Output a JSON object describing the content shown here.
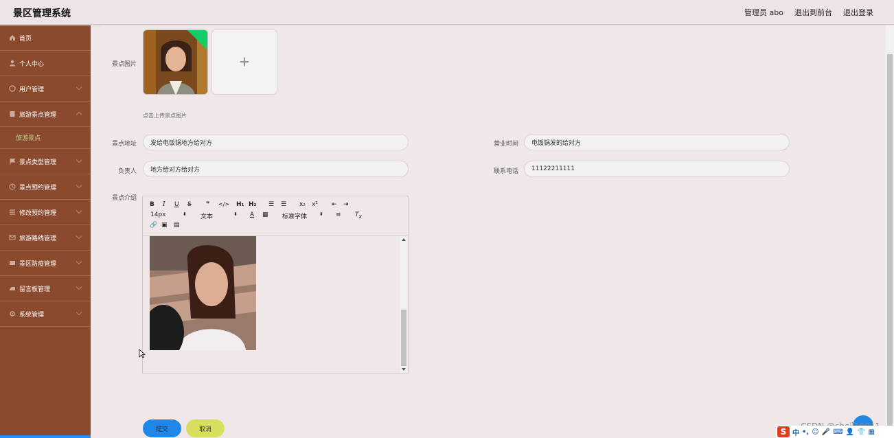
{
  "app": {
    "title": "景区管理系统"
  },
  "topnav": {
    "admin": "管理员 abo",
    "front": "退出到前台",
    "logout": "退出登录"
  },
  "sidebar": {
    "items": [
      {
        "label": "首页",
        "icon": "home-icon"
      },
      {
        "label": "个人中心",
        "icon": "user-icon"
      },
      {
        "label": "用户管理",
        "icon": "users-icon"
      },
      {
        "label": "旅游景点管理",
        "icon": "scenic-icon"
      },
      {
        "label": "景点类型管理",
        "icon": "flag-icon"
      },
      {
        "label": "景点预约管理",
        "icon": "clock-icon"
      },
      {
        "label": "修改预约管理",
        "icon": "list-icon"
      },
      {
        "label": "旅游路线管理",
        "icon": "mail-icon"
      },
      {
        "label": "景区防疫管理",
        "icon": "shield-icon"
      },
      {
        "label": "留言板管理",
        "icon": "message-icon"
      },
      {
        "label": "系统管理",
        "icon": "gear-icon"
      }
    ],
    "subitem": "旅游景点"
  },
  "form": {
    "image_label": "景点图片",
    "upload_hint": "点击上传景点图片",
    "address_label": "景点地址",
    "address_value": "发给电饭锅地方给对方",
    "hours_label": "营业时间",
    "hours_value": "电饭锅发的给对方",
    "person_label": "负责人",
    "person_value": "地方给对方给对方",
    "phone_label": "联系电话",
    "phone_value": "11122211111",
    "intro_label": "景点介绍"
  },
  "editor": {
    "font_size": "14px",
    "header_select": "文本",
    "font_family": "标准字体"
  },
  "buttons": {
    "submit": "提交",
    "cancel": "取消"
  },
  "watermark": "CSDN @shejì10011",
  "ime": {
    "mode": "中"
  }
}
